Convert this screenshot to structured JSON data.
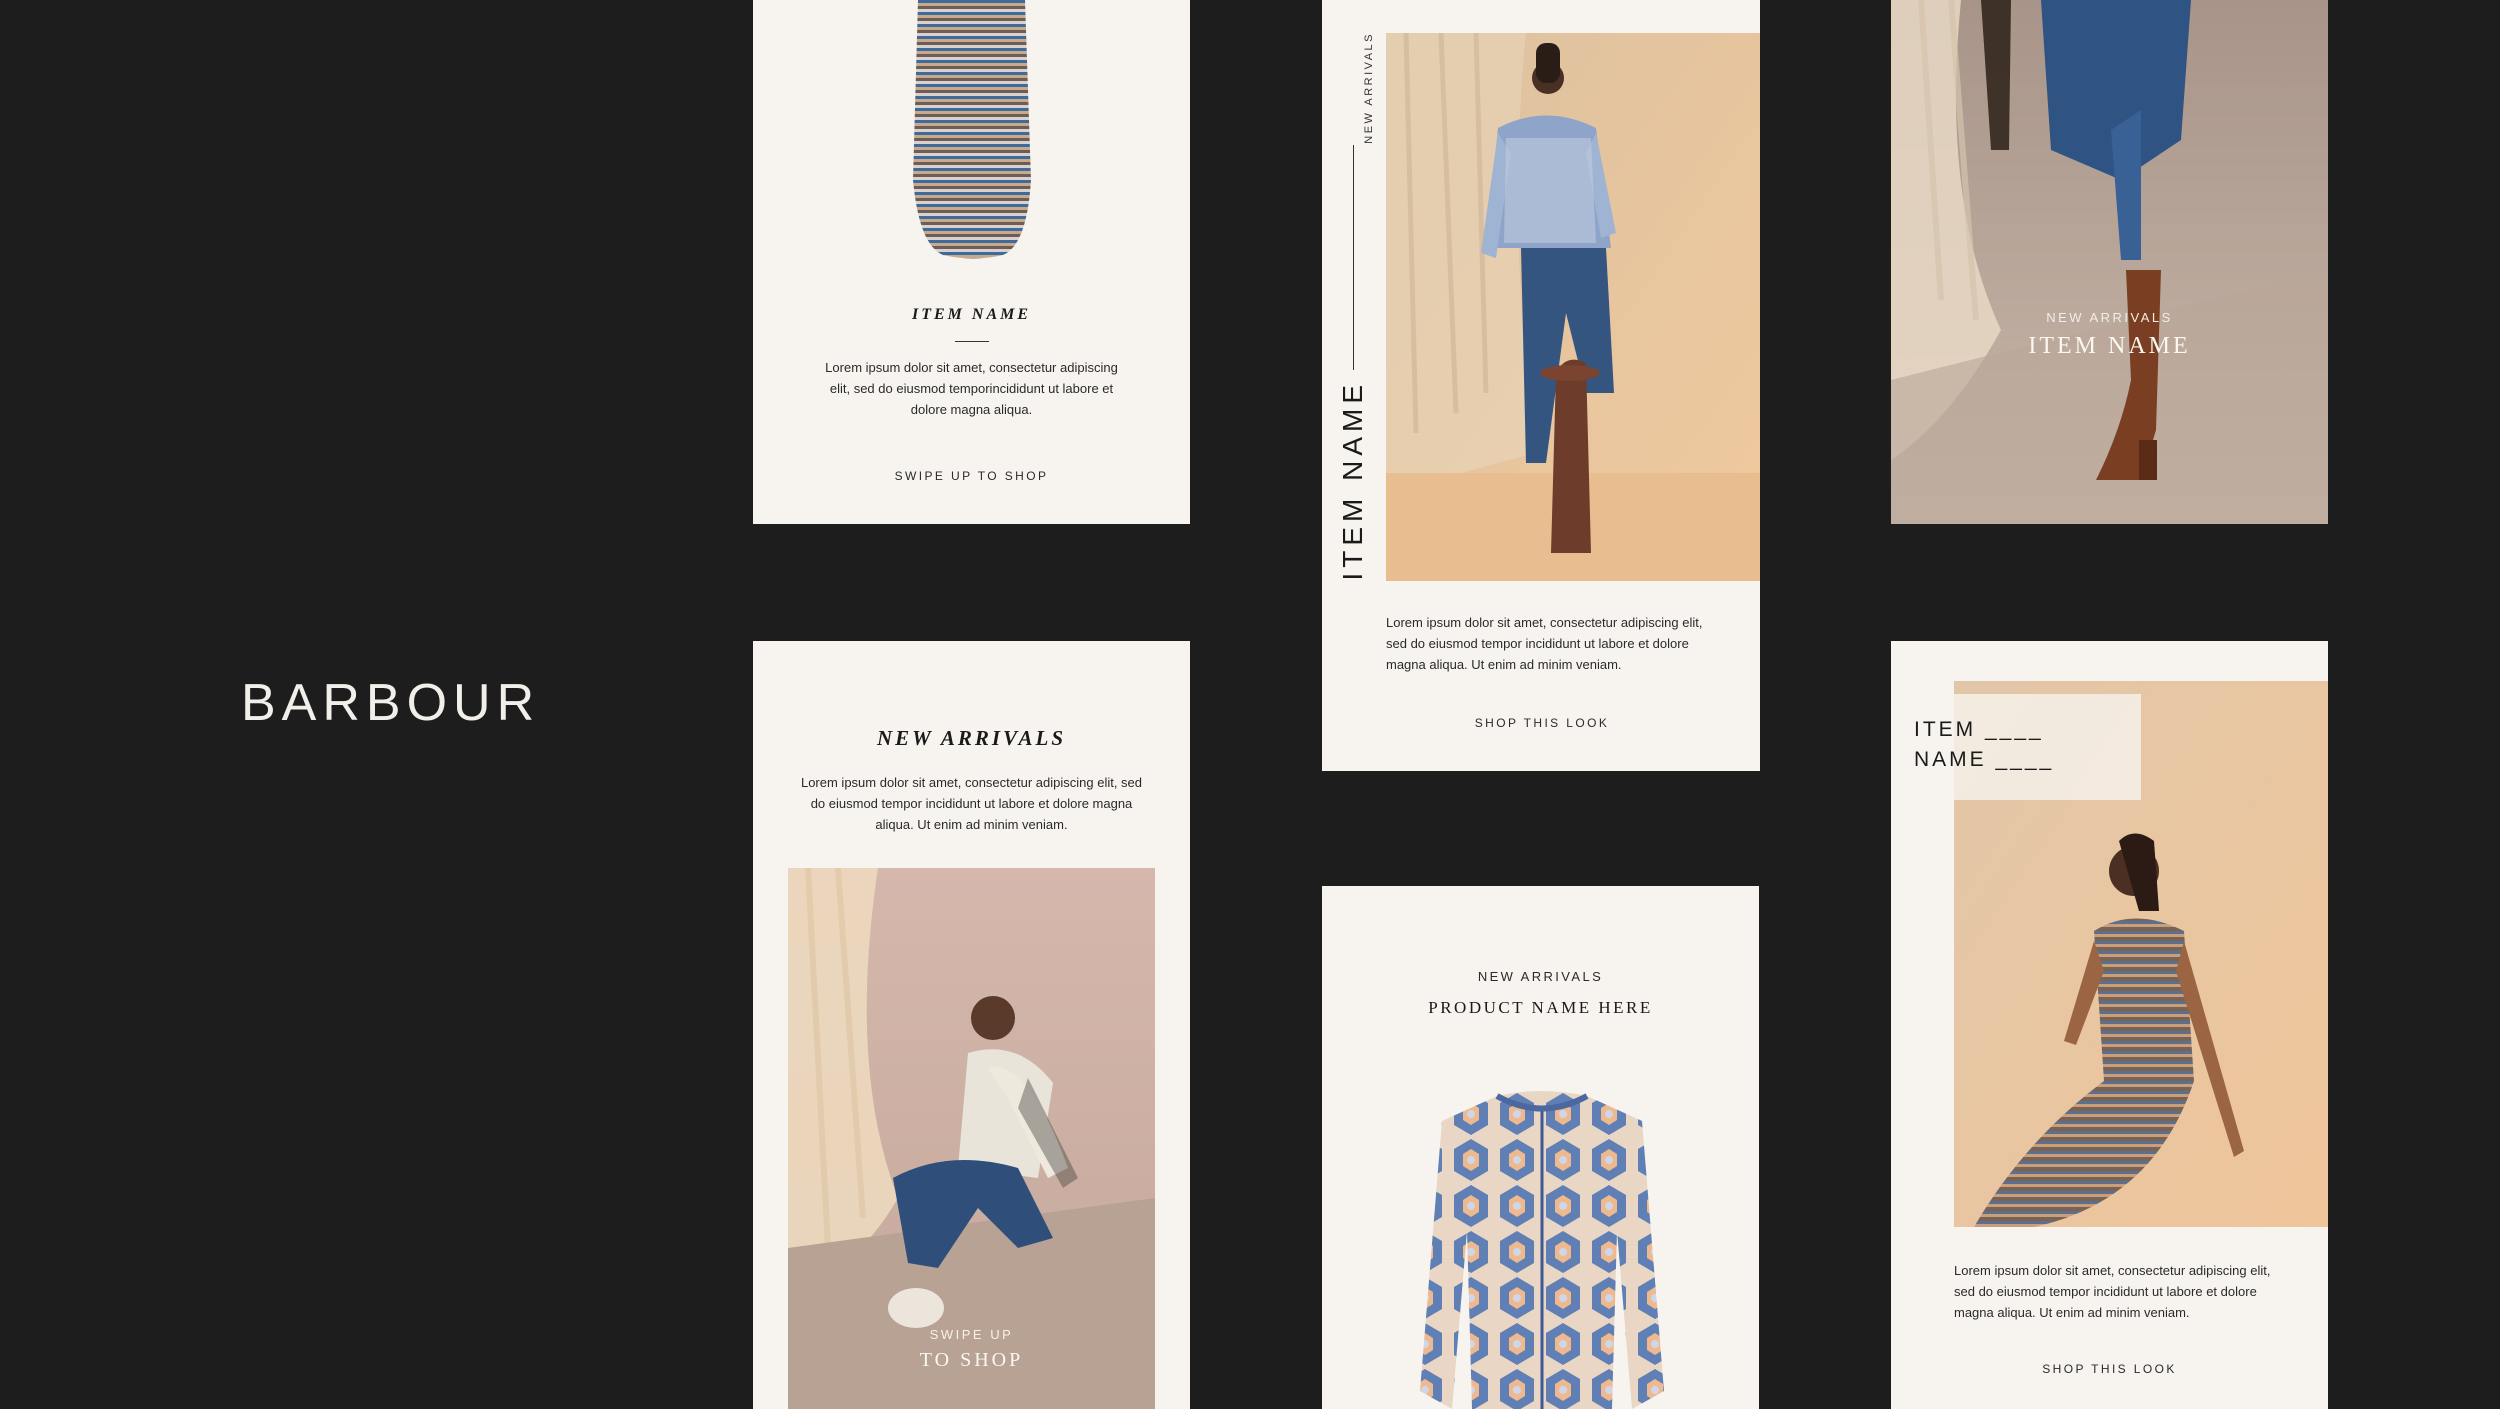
{
  "brand": "BARBOUR",
  "card_skirt": {
    "title": "ITEM NAME",
    "body": "Lorem ipsum dolor sit amet, consectetur adipiscing elit, sed do eiusmod temporincididunt ut labore et dolore magna aliqua.",
    "cta": "SWIPE UP TO SHOP"
  },
  "card_vertical": {
    "side_small": "NEW ARRIVALS",
    "side_large": "ITEM NAME",
    "body": "Lorem ipsum dolor sit amet, consectetur adipiscing elit, sed do eiusmod tempor incididunt ut labore et dolore magna aliqua. Ut enim ad minim veniam.",
    "cta": "SHOP THIS LOOK"
  },
  "card_boots": {
    "kicker": "NEW ARRIVALS",
    "title": "ITEM NAME"
  },
  "card_new_arrivals": {
    "title": "NEW ARRIVALS",
    "body": "Lorem ipsum dolor sit amet, consectetur adipiscing elit, sed do eiusmod tempor incididunt ut labore et dolore magna aliqua. Ut enim ad minim veniam.",
    "overlay_small": "SWIPE UP",
    "overlay_large": "TO SHOP"
  },
  "card_product": {
    "kicker": "NEW ARRIVALS",
    "title": "PRODUCT NAME HERE"
  },
  "card_dress": {
    "label_line1": "ITEM ____",
    "label_line2": "NAME ____",
    "body": "Lorem ipsum dolor sit amet, consectetur adipiscing elit, sed do eiusmod tempor incididunt ut labore et dolore magna aliqua. Ut enim ad minim veniam.",
    "cta": "SHOP THIS LOOK"
  },
  "colors": {
    "background": "#1d1d1e",
    "card": "#f7f4f0",
    "text": "#1a1a1a",
    "photo_warm": "#e9c7a1",
    "photo_pink": "#d3b8ab"
  }
}
